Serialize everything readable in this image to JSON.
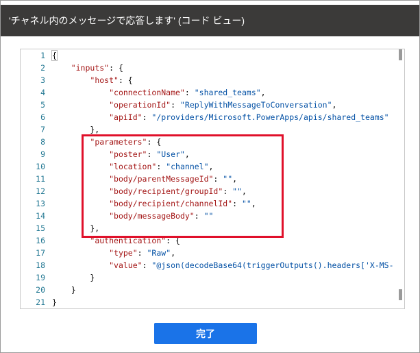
{
  "dialog": {
    "title": "'チャネル内のメッセージで応答します' (コード ビュー)",
    "done_label": "完了"
  },
  "editor": {
    "lines": [
      {
        "n": "1",
        "tokens": [
          {
            "t": "{",
            "c": "p"
          }
        ]
      },
      {
        "n": "2",
        "tokens": [
          {
            "t": "    ",
            "c": "p"
          },
          {
            "t": "\"inputs\"",
            "c": "k"
          },
          {
            "t": ": {",
            "c": "p"
          }
        ]
      },
      {
        "n": "3",
        "tokens": [
          {
            "t": "        ",
            "c": "p"
          },
          {
            "t": "\"host\"",
            "c": "k"
          },
          {
            "t": ": {",
            "c": "p"
          }
        ]
      },
      {
        "n": "4",
        "tokens": [
          {
            "t": "            ",
            "c": "p"
          },
          {
            "t": "\"connectionName\"",
            "c": "k"
          },
          {
            "t": ": ",
            "c": "p"
          },
          {
            "t": "\"shared_teams\"",
            "c": "s"
          },
          {
            "t": ",",
            "c": "p"
          }
        ]
      },
      {
        "n": "5",
        "tokens": [
          {
            "t": "            ",
            "c": "p"
          },
          {
            "t": "\"operationId\"",
            "c": "k"
          },
          {
            "t": ": ",
            "c": "p"
          },
          {
            "t": "\"ReplyWithMessageToConversation\"",
            "c": "s"
          },
          {
            "t": ",",
            "c": "p"
          }
        ]
      },
      {
        "n": "6",
        "tokens": [
          {
            "t": "            ",
            "c": "p"
          },
          {
            "t": "\"apiId\"",
            "c": "k"
          },
          {
            "t": ": ",
            "c": "p"
          },
          {
            "t": "\"/providers/Microsoft.PowerApps/apis/shared_teams\"",
            "c": "s"
          }
        ]
      },
      {
        "n": "7",
        "tokens": [
          {
            "t": "        },",
            "c": "p"
          }
        ]
      },
      {
        "n": "8",
        "tokens": [
          {
            "t": "        ",
            "c": "p"
          },
          {
            "t": "\"parameters\"",
            "c": "k"
          },
          {
            "t": ": {",
            "c": "p"
          }
        ]
      },
      {
        "n": "9",
        "tokens": [
          {
            "t": "            ",
            "c": "p"
          },
          {
            "t": "\"poster\"",
            "c": "k"
          },
          {
            "t": ": ",
            "c": "p"
          },
          {
            "t": "\"User\"",
            "c": "s"
          },
          {
            "t": ",",
            "c": "p"
          }
        ]
      },
      {
        "n": "10",
        "tokens": [
          {
            "t": "            ",
            "c": "p"
          },
          {
            "t": "\"location\"",
            "c": "k"
          },
          {
            "t": ": ",
            "c": "p"
          },
          {
            "t": "\"channel\"",
            "c": "s"
          },
          {
            "t": ",",
            "c": "p"
          }
        ]
      },
      {
        "n": "11",
        "tokens": [
          {
            "t": "            ",
            "c": "p"
          },
          {
            "t": "\"body/parentMessageId\"",
            "c": "k"
          },
          {
            "t": ": ",
            "c": "p"
          },
          {
            "t": "\"\"",
            "c": "s"
          },
          {
            "t": ",",
            "c": "p"
          }
        ]
      },
      {
        "n": "12",
        "tokens": [
          {
            "t": "            ",
            "c": "p"
          },
          {
            "t": "\"body/recipient/groupId\"",
            "c": "k"
          },
          {
            "t": ": ",
            "c": "p"
          },
          {
            "t": "\"\"",
            "c": "s"
          },
          {
            "t": ",",
            "c": "p"
          }
        ]
      },
      {
        "n": "13",
        "tokens": [
          {
            "t": "            ",
            "c": "p"
          },
          {
            "t": "\"body/recipient/channelId\"",
            "c": "k"
          },
          {
            "t": ": ",
            "c": "p"
          },
          {
            "t": "\"\"",
            "c": "s"
          },
          {
            "t": ",",
            "c": "p"
          }
        ]
      },
      {
        "n": "14",
        "tokens": [
          {
            "t": "            ",
            "c": "p"
          },
          {
            "t": "\"body/messageBody\"",
            "c": "k"
          },
          {
            "t": ": ",
            "c": "p"
          },
          {
            "t": "\"\"",
            "c": "s"
          }
        ]
      },
      {
        "n": "15",
        "tokens": [
          {
            "t": "        },",
            "c": "p"
          }
        ]
      },
      {
        "n": "16",
        "tokens": [
          {
            "t": "        ",
            "c": "p"
          },
          {
            "t": "\"authentication\"",
            "c": "k"
          },
          {
            "t": ": {",
            "c": "p"
          }
        ]
      },
      {
        "n": "17",
        "tokens": [
          {
            "t": "            ",
            "c": "p"
          },
          {
            "t": "\"type\"",
            "c": "k"
          },
          {
            "t": ": ",
            "c": "p"
          },
          {
            "t": "\"Raw\"",
            "c": "s"
          },
          {
            "t": ",",
            "c": "p"
          }
        ]
      },
      {
        "n": "18",
        "tokens": [
          {
            "t": "            ",
            "c": "p"
          },
          {
            "t": "\"value\"",
            "c": "k"
          },
          {
            "t": ": ",
            "c": "p"
          },
          {
            "t": "\"@json(decodeBase64(triggerOutputs().headers['X-MS-",
            "c": "s"
          }
        ]
      },
      {
        "n": "19",
        "tokens": [
          {
            "t": "        }",
            "c": "p"
          }
        ]
      },
      {
        "n": "20",
        "tokens": [
          {
            "t": "    }",
            "c": "p"
          }
        ]
      },
      {
        "n": "21",
        "tokens": [
          {
            "t": "}",
            "c": "p"
          }
        ]
      }
    ]
  },
  "colors": {
    "titlebar_bg": "#3b3a39",
    "button_bg": "#1a73e8",
    "highlight_border": "#e0102a"
  }
}
